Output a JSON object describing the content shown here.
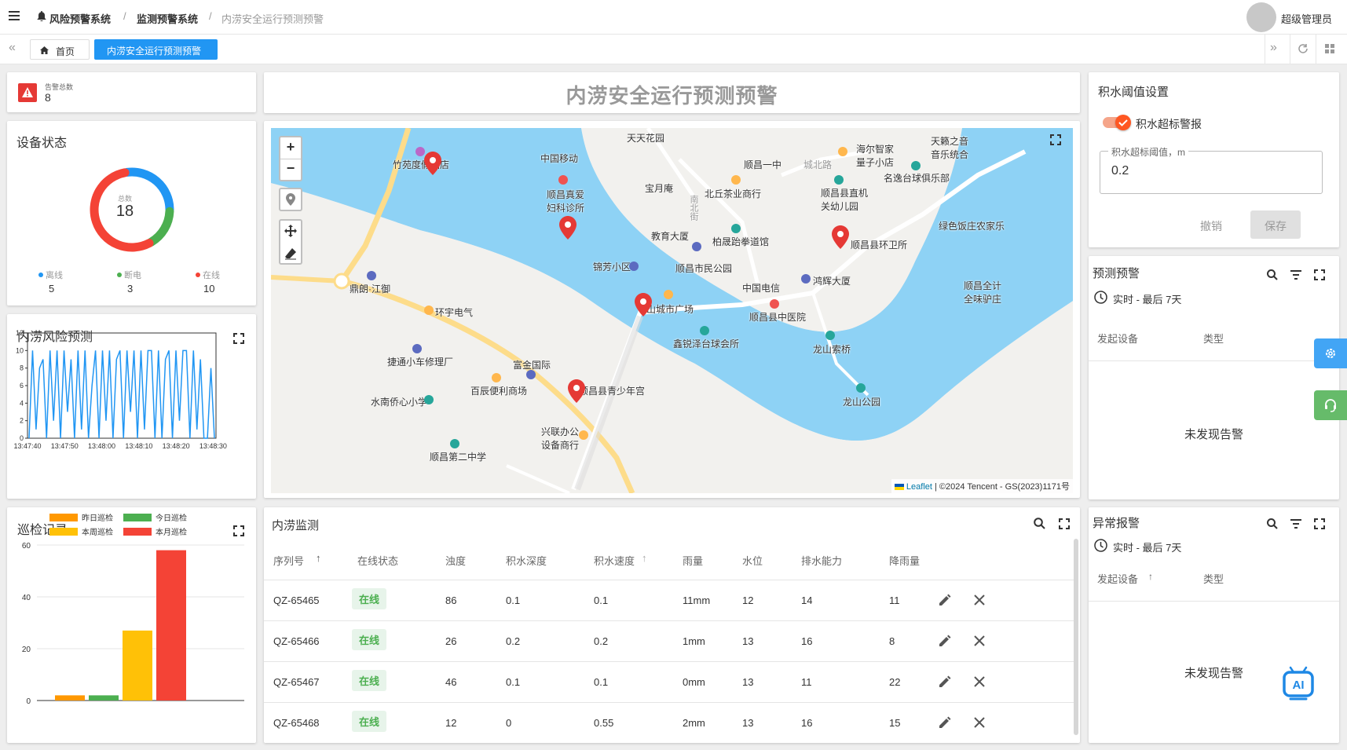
{
  "header": {
    "breadcrumb": [
      "风险预警系统",
      "监测预警系统",
      "内涝安全运行预测预警"
    ],
    "user": "超级管理员"
  },
  "tabs": {
    "home": "首页",
    "active": "内涝安全运行预测预警"
  },
  "alarm_total": {
    "label": "告警总数",
    "value": "8"
  },
  "device_status": {
    "title": "设备状态",
    "total_label": "总数",
    "total": "18",
    "legend": [
      {
        "label": "离线",
        "value": "5",
        "color": "#2196f3"
      },
      {
        "label": "断电",
        "value": "3",
        "color": "#4caf50"
      },
      {
        "label": "在线",
        "value": "10",
        "color": "#f44336"
      }
    ]
  },
  "risk_prediction": {
    "title": "内涝风险预测",
    "chart_data": {
      "type": "line",
      "x_ticks": [
        "13:47:40",
        "13:47:50",
        "13:48:00",
        "13:48:10",
        "13:48:20",
        "13:48:30"
      ],
      "ylim": [
        0,
        12
      ],
      "y_ticks": [
        "0",
        "2",
        "4",
        "6",
        "8",
        "10",
        "12"
      ],
      "series": [
        {
          "values": [
            0,
            10,
            1,
            8,
            9,
            0,
            10,
            2,
            10,
            0,
            10,
            3,
            9,
            0,
            10,
            1,
            10,
            0,
            6,
            10,
            0,
            10,
            2,
            10,
            0,
            9,
            10,
            0,
            10,
            3,
            10,
            0,
            10,
            1,
            10,
            10,
            0,
            10,
            0,
            9,
            10,
            0,
            10,
            2,
            10,
            10,
            0,
            10,
            1,
            9,
            0,
            0,
            8,
            0
          ]
        }
      ],
      "color": "#2196f3"
    }
  },
  "patrol": {
    "title": "巡检记录",
    "chart_data": {
      "type": "bar",
      "categories": [
        "昨日巡检",
        "今日巡检",
        "本周巡检",
        "本月巡检"
      ],
      "values": [
        2,
        2,
        27,
        58
      ],
      "colors": [
        "#ff9800",
        "#4caf50",
        "#ffc107",
        "#f44336"
      ],
      "ylim": [
        0,
        60
      ],
      "y_ticks": [
        "0",
        "20",
        "40",
        "60"
      ]
    }
  },
  "main_title": "内涝安全运行预测预警",
  "map": {
    "attribution_link": "Leaflet",
    "attribution_text": "| ©2024 Tencent - GS(2023)1171号",
    "labels": [
      "天天花园",
      "中国移动",
      "竹苑度假酒店",
      "顺昌真爱妇科诊所",
      "宝月庵",
      "北丘茶业商行",
      "顺昌一中",
      "城北路",
      "海尔智家量子小店",
      "天籁之音音乐统合",
      "名逸台球俱乐部",
      "顺昌县直机关幼儿园",
      "绿色饭庄农家乐",
      "教育大厦",
      "柏晟跆拳道馆",
      "锦芳小区",
      "顺昌市民公园",
      "顺昌县环卫所",
      "中国电信",
      "鸿辉大厦",
      "顺昌全计全味驴庄",
      "鼎朗·江御",
      "环宇电气",
      "山城市广场",
      "顺昌县中医院",
      "鑫锐泽台球会所",
      "龙山索桥",
      "捷通小车修理厂",
      "富金国际",
      "百辰便利商场",
      "顺昌县青少年宫",
      "水南侨心小学",
      "龙山公园",
      "兴联办公设备商行",
      "顺昌第二中学",
      "南北街"
    ]
  },
  "threshold": {
    "title": "积水阈值设置",
    "toggle_label": "积水超标警报",
    "toggle_on": true,
    "input_label": "积水超标阈值，m",
    "input_value": "0.2",
    "cancel": "撤销",
    "save": "保存"
  },
  "forecast": {
    "title": "预测预警",
    "range": "实时 - 最后 7天",
    "col1": "发起设备",
    "col2": "类型",
    "empty": "未发现告警"
  },
  "abnormal": {
    "title": "异常报警",
    "range": "实时 - 最后 7天",
    "col1": "发起设备",
    "col2": "类型",
    "empty": "未发现告警"
  },
  "monitor": {
    "title": "内涝监测",
    "columns": [
      "序列号",
      "在线状态",
      "浊度",
      "积水深度",
      "积水速度",
      "雨量",
      "水位",
      "排水能力",
      "降雨量"
    ],
    "rows": [
      {
        "id": "QZ-65465",
        "status": "在线",
        "turb": "86",
        "depth": "0.1",
        "speed": "0.1",
        "rain": "11mm",
        "level": "12",
        "drain": "14",
        "rainfall": "11"
      },
      {
        "id": "QZ-65466",
        "status": "在线",
        "turb": "26",
        "depth": "0.2",
        "speed": "0.2",
        "rain": "1mm",
        "level": "13",
        "drain": "16",
        "rainfall": "8"
      },
      {
        "id": "QZ-65467",
        "status": "在线",
        "turb": "46",
        "depth": "0.1",
        "speed": "0.1",
        "rain": "0mm",
        "level": "13",
        "drain": "11",
        "rainfall": "22"
      },
      {
        "id": "QZ-65468",
        "status": "在线",
        "turb": "12",
        "depth": "0",
        "speed": "0.55",
        "rain": "2mm",
        "level": "13",
        "drain": "16",
        "rainfall": "15"
      }
    ]
  }
}
